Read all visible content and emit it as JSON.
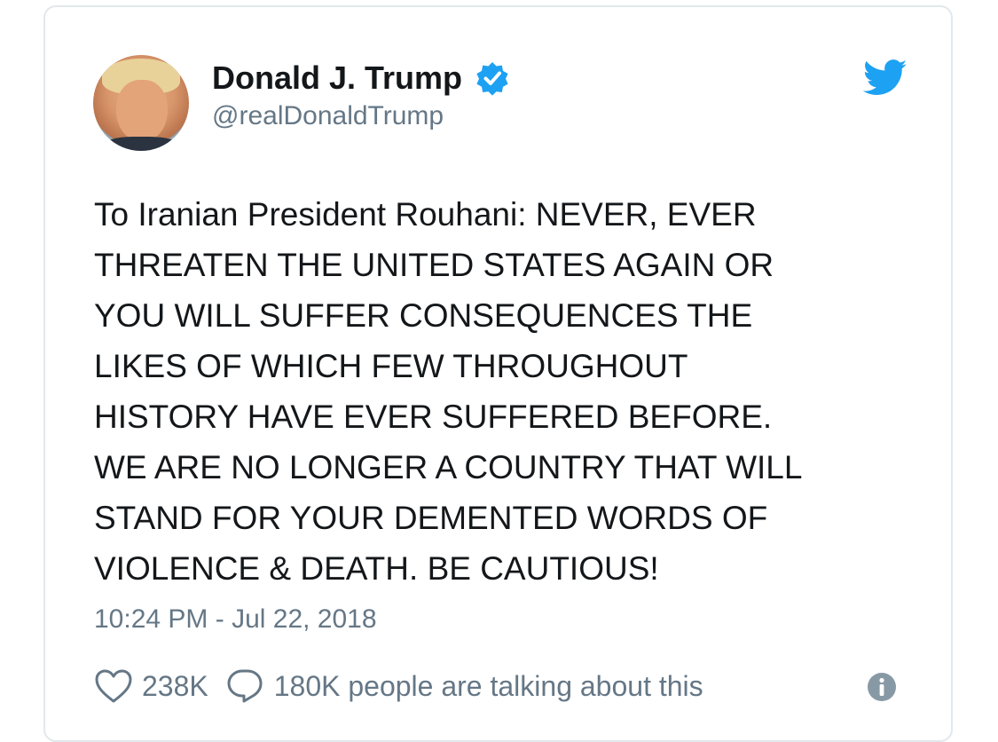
{
  "author": {
    "display_name": "Donald J. Trump",
    "handle": "@realDonaldTrump",
    "verified_icon": "verified-badge-icon",
    "avatar": "profile-photo"
  },
  "brand": {
    "icon": "twitter-bird-icon",
    "color": "#1da1f2"
  },
  "tweet": {
    "text": "To Iranian President Rouhani: NEVER, EVER\nTHREATEN THE UNITED STATES AGAIN OR\nYOU WILL SUFFER CONSEQUENCES THE\nLIKES OF WHICH FEW THROUGHOUT\nHISTORY HAVE EVER SUFFERED BEFORE.\nWE ARE NO LONGER A COUNTRY THAT WILL\nSTAND FOR YOUR DEMENTED WORDS OF\nVIOLENCE & DEATH. BE CAUTIOUS!",
    "timestamp": "10:24 PM - Jul 22, 2018"
  },
  "actions": {
    "like_icon": "heart-icon",
    "like_count": "238K",
    "reply_icon": "speech-bubble-icon",
    "talking_text": "180K people are talking about this",
    "info_icon": "info-icon"
  },
  "colors": {
    "text": "#14171a",
    "secondary": "#657786",
    "border": "#e1e8ed",
    "verified": "#1da1f2"
  }
}
